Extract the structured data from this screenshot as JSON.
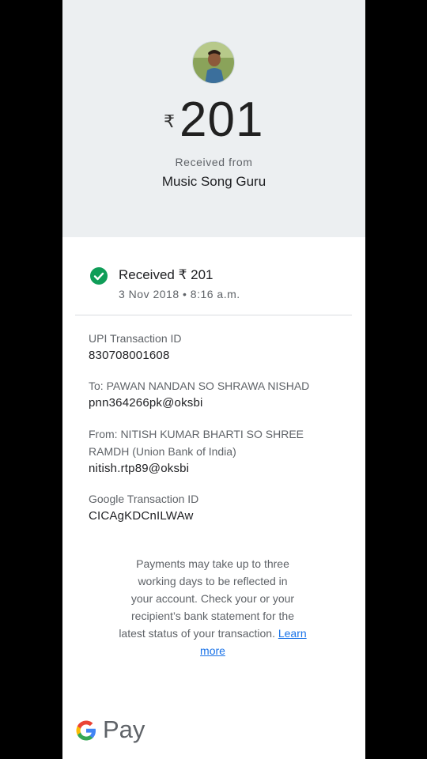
{
  "header": {
    "currency_symbol": "₹",
    "amount": "201",
    "received_from_label": "Received from",
    "sender_name": "Music Song Guru"
  },
  "status": {
    "label": "Received ₹ 201",
    "timestamp": "3 Nov 2018 • 8:16 a.m."
  },
  "details": {
    "upi_label": "UPI Transaction ID",
    "upi_value": "830708001608",
    "to_label": "To: PAWAN NANDAN SO SHRAWA NISHAD",
    "to_value": "pnn364266pk@oksbi",
    "from_label_line1": "From: NITISH KUMAR BHARTI SO SHREE",
    "from_label_line2": "RAMDH (Union Bank of India)",
    "from_value": "nitish.rtp89@oksbi",
    "google_label": "Google Transaction ID",
    "google_value": "CICAgKDCnILWAw"
  },
  "note": {
    "line1": "Payments may take up to three",
    "line2": "working days to be reflected in",
    "line3": "your account. Check your or your",
    "line4": "recipient’s bank statement for the",
    "line5_prefix": "latest status of your transaction.",
    "learn": "Learn",
    "more": "more"
  },
  "brand": {
    "name": "Pay",
    "g_colors": [
      "#4285F4",
      "#EA4335",
      "#FBBC05",
      "#34A853"
    ]
  },
  "colors": {
    "success": "#0f9d58",
    "link": "#1a73e8",
    "hero_bg": "#eceff1"
  }
}
